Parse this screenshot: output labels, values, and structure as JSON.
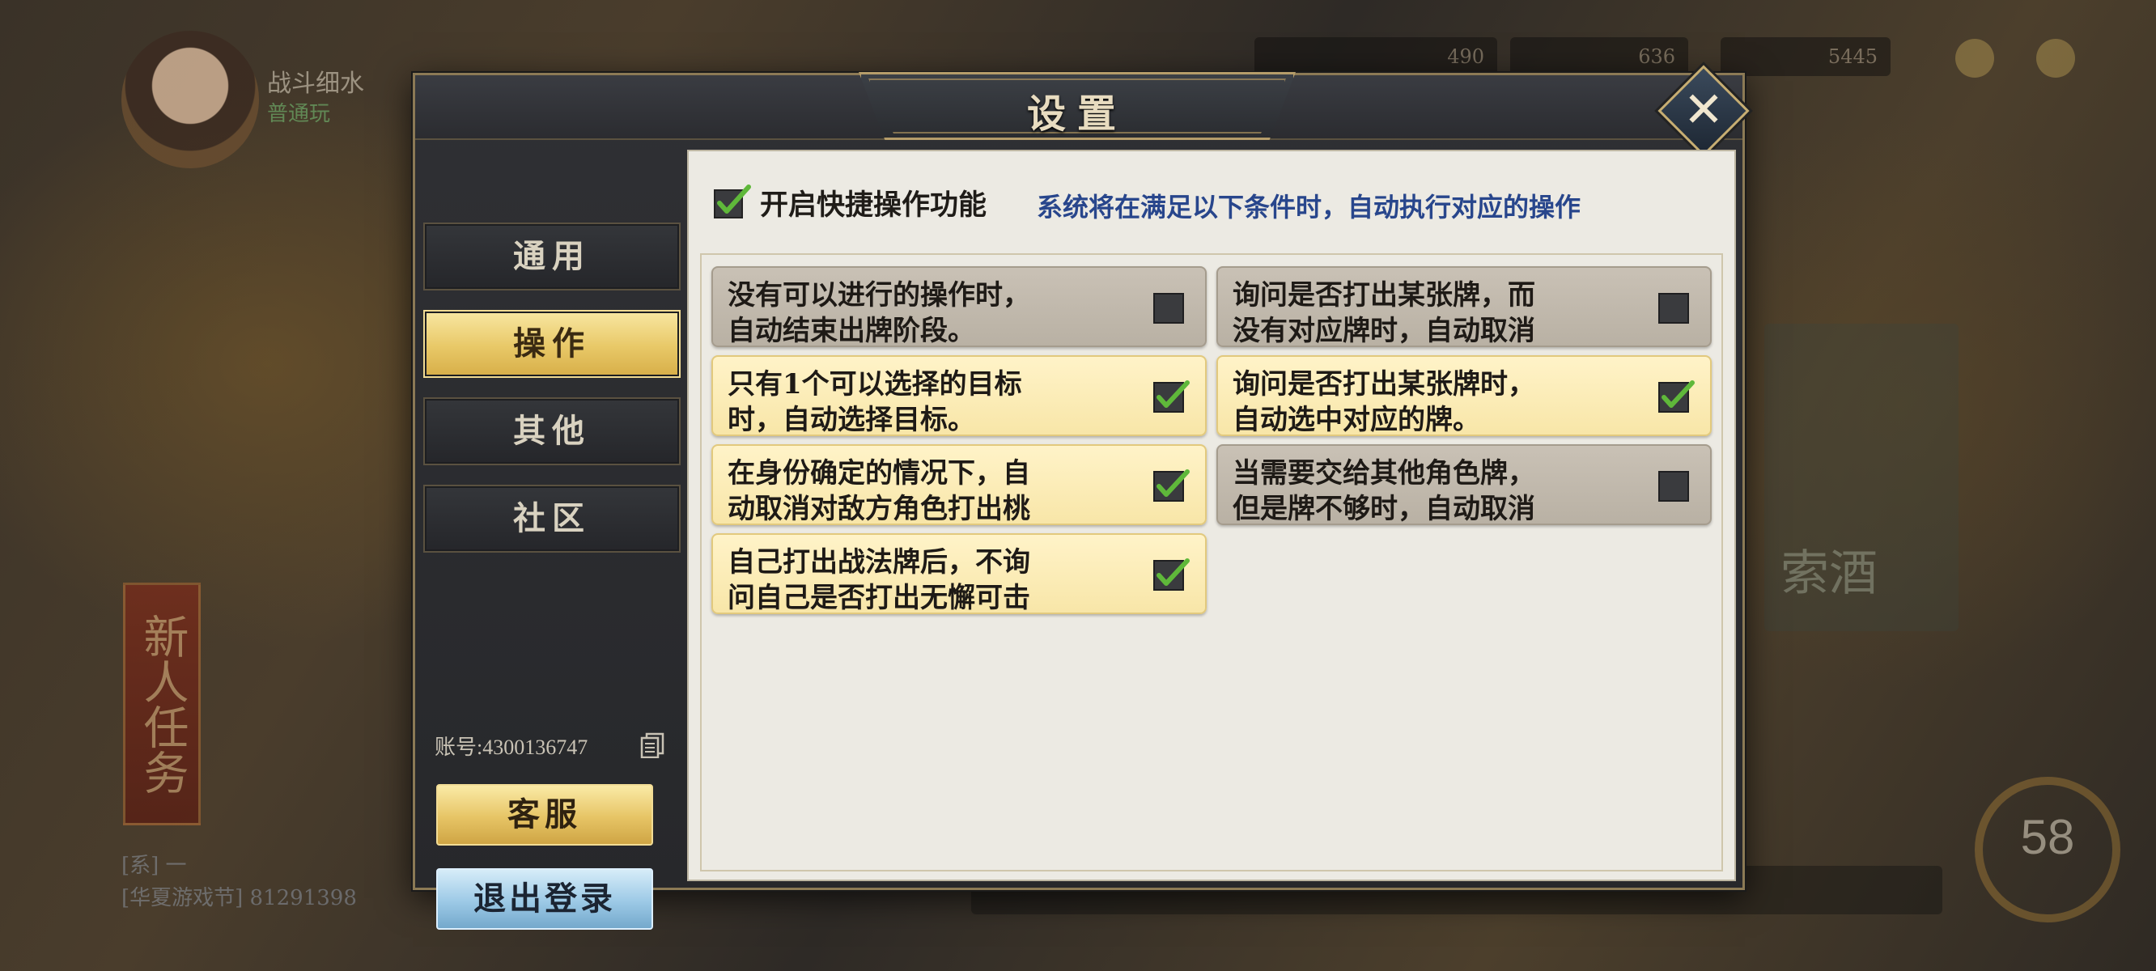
{
  "background": {
    "player_name": "战斗细水",
    "player_level": "普通玩",
    "top_values": [
      "490",
      "636",
      "5445"
    ],
    "banner_text": "新人任务",
    "news_lines": [
      "[系] 一",
      "[华夏游戏节] 81291398"
    ],
    "right_title": "索酒",
    "level_badge": "58"
  },
  "dialog": {
    "title": "设置",
    "close_glyph": "✕"
  },
  "sidebar": {
    "tabs": [
      {
        "label": "通用",
        "active": false
      },
      {
        "label": "操作",
        "active": true
      },
      {
        "label": "其他",
        "active": false
      },
      {
        "label": "社区",
        "active": false
      }
    ],
    "account_text": "账号:4300136747",
    "service_button": "客服",
    "logout_button": "退出登录"
  },
  "content": {
    "master_toggle": {
      "checked": true,
      "label": "开启快捷操作功能",
      "hint": "系统将在满足以下条件时，自动执行对应的操作"
    },
    "options": [
      {
        "line1": "没有可以进行的操作时，",
        "line2": "自动结束出牌阶段。",
        "checked": false
      },
      {
        "line1": "询问是否打出某张牌，而",
        "line2": "没有对应牌时，自动取消",
        "checked": false
      },
      {
        "line1": "只有1个可以选择的目标",
        "line2": "时，自动选择目标。",
        "checked": true
      },
      {
        "line1": "询问是否打出某张牌时，",
        "line2": "自动选中对应的牌。",
        "checked": true
      },
      {
        "line1": "在身份确定的情况下，自",
        "line2": "动取消对敌方角色打出桃",
        "checked": true
      },
      {
        "line1": "当需要交给其他角色牌，",
        "line2": "但是牌不够时，自动取消",
        "checked": false
      },
      {
        "line1": "自己打出战法牌后，不询",
        "line2": "问自己是否打出无懈可击",
        "checked": true
      }
    ]
  },
  "colors": {
    "active_tab_gold": "#e8c867",
    "hint_blue": "#28468c",
    "check_green": "#5fb83a",
    "option_on_bg": "#f8e6a8",
    "option_off_bg": "#bdb5a8"
  }
}
